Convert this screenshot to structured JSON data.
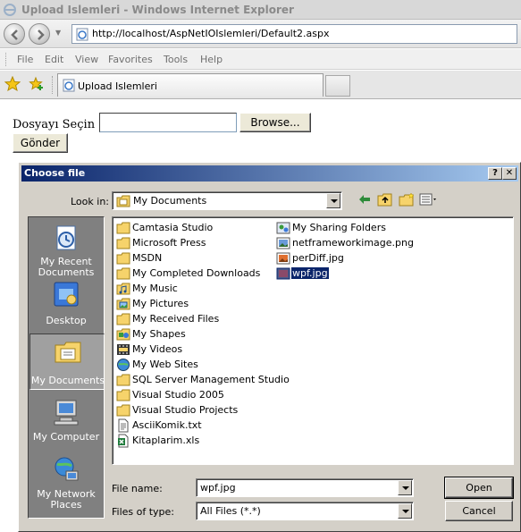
{
  "window": {
    "title": "Upload Islemleri - Windows Internet Explorer",
    "url": "http://localhost/AspNetIOIslemleri/Default2.aspx"
  },
  "menu": [
    "File",
    "Edit",
    "View",
    "Favorites",
    "Tools",
    "Help"
  ],
  "tab": {
    "label": "Upload Islemleri"
  },
  "form": {
    "label": "Dosyayı Seçin :",
    "file_value": "",
    "browse_label": "Browse...",
    "submit_label": "Gönder"
  },
  "dialog": {
    "title": "Choose file",
    "help_glyph": "?",
    "close_glyph": "✕",
    "look_in_label": "Look in:",
    "look_in_value": "My Documents",
    "places": [
      {
        "label": "My Recent Documents",
        "icon": "recent-documents-icon"
      },
      {
        "label": "Desktop",
        "icon": "desktop-icon"
      },
      {
        "label": "My Documents",
        "icon": "my-documents-icon",
        "selected": true
      },
      {
        "label": "My Computer",
        "icon": "my-computer-icon"
      },
      {
        "label": "My Network Places",
        "icon": "network-places-icon"
      }
    ],
    "files": [
      {
        "name": "Camtasia Studio",
        "icon": "folder-icon"
      },
      {
        "name": "Microsoft Press",
        "icon": "folder-icon"
      },
      {
        "name": "MSDN",
        "icon": "folder-icon"
      },
      {
        "name": "My Completed Downloads",
        "icon": "folder-icon"
      },
      {
        "name": "My Music",
        "icon": "music-folder-icon"
      },
      {
        "name": "My Pictures",
        "icon": "pictures-folder-icon"
      },
      {
        "name": "My Received Files",
        "icon": "folder-icon"
      },
      {
        "name": "My Shapes",
        "icon": "shapes-folder-icon"
      },
      {
        "name": "My Videos",
        "icon": "videos-folder-icon"
      },
      {
        "name": "My Web Sites",
        "icon": "web-sites-folder-icon"
      },
      {
        "name": "SQL Server Management Studio",
        "icon": "folder-icon"
      },
      {
        "name": "Visual Studio 2005",
        "icon": "folder-icon"
      },
      {
        "name": "Visual Studio Projects",
        "icon": "folder-icon"
      },
      {
        "name": "AsciiKomik.txt",
        "icon": "text-file-icon"
      },
      {
        "name": "Kitaplarim.xls",
        "icon": "excel-file-icon"
      },
      {
        "name": "My Sharing Folders",
        "icon": "sharing-folder-icon"
      },
      {
        "name": "netframeworkimage.png",
        "icon": "png-file-icon"
      },
      {
        "name": "perDiff.jpg",
        "icon": "jpg-file-icon"
      },
      {
        "name": "wpf.jpg",
        "icon": "jpg-file-icon",
        "selected": true
      }
    ],
    "file_name_label": "File name:",
    "file_name_value": "wpf.jpg",
    "file_type_label": "Files of type:",
    "file_type_value": "All Files (*.*)",
    "open_label": "Open",
    "cancel_label": "Cancel"
  },
  "colors": {
    "dialog_face": "#d4d0c8",
    "title_gradient_start": "#0a246a",
    "selection": "#0a246a",
    "places_bar": "#808080",
    "folder_yellow": "#f6d36b"
  }
}
